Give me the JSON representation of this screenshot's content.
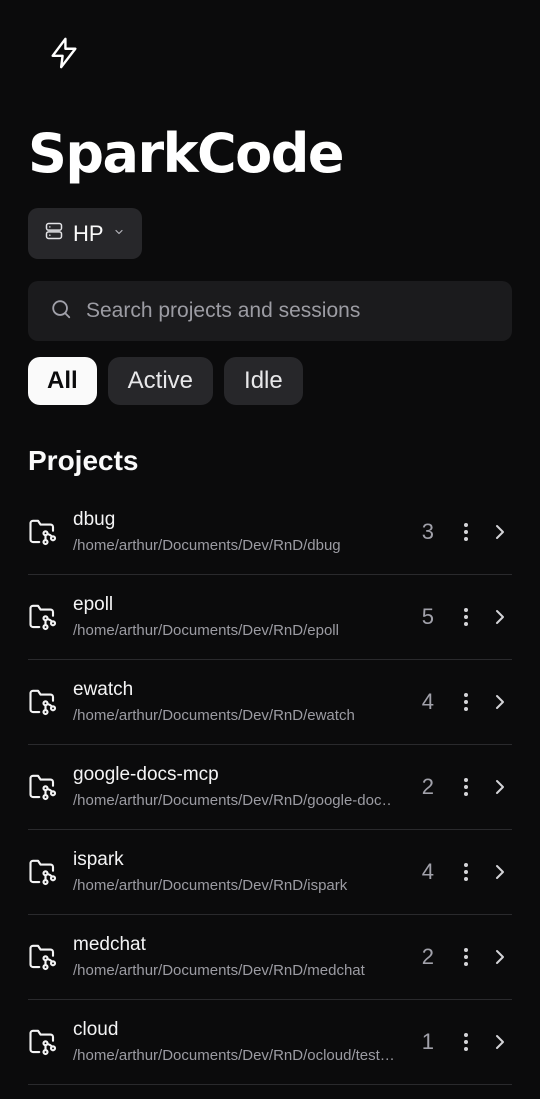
{
  "app": {
    "title": "SparkCode"
  },
  "host": {
    "label": "HP"
  },
  "search": {
    "placeholder": "Search projects and sessions"
  },
  "filters": [
    {
      "label": "All",
      "active": true
    },
    {
      "label": "Active",
      "active": false
    },
    {
      "label": "Idle",
      "active": false
    }
  ],
  "projects": {
    "heading": "Projects",
    "items": [
      {
        "name": "dbug",
        "path": "/home/arthur/Documents/Dev/RnD/dbug",
        "count": "3"
      },
      {
        "name": "epoll",
        "path": "/home/arthur/Documents/Dev/RnD/epoll",
        "count": "5"
      },
      {
        "name": "ewatch",
        "path": "/home/arthur/Documents/Dev/RnD/ewatch",
        "count": "4"
      },
      {
        "name": "google-docs-mcp",
        "path": "/home/arthur/Documents/Dev/RnD/google-doc…",
        "count": "2"
      },
      {
        "name": "ispark",
        "path": "/home/arthur/Documents/Dev/RnD/ispark",
        "count": "4"
      },
      {
        "name": "medchat",
        "path": "/home/arthur/Documents/Dev/RnD/medchat",
        "count": "2"
      },
      {
        "name": "cloud",
        "path": "/home/arthur/Documents/Dev/RnD/ocloud/test…",
        "count": "1"
      }
    ]
  },
  "colors": {
    "background": "#0b0b0c",
    "surface": "#27272a",
    "muted": "#9c9ca3"
  }
}
